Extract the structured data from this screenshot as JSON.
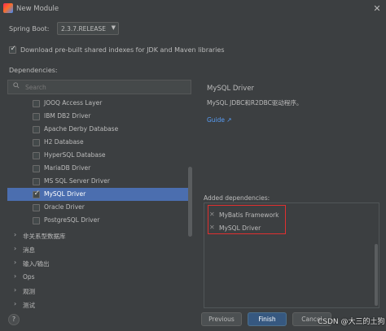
{
  "window": {
    "title": "New Module",
    "close_glyph": "✕"
  },
  "spring_boot": {
    "label": "Spring Boot:",
    "value": "2.3.7.RELEASE"
  },
  "download_indexes": {
    "label": "Download pre-built shared indexes for JDK and Maven libraries",
    "checked": true
  },
  "dependencies": {
    "label": "Dependencies:",
    "search_placeholder": "Search",
    "items": [
      {
        "label": "JOOQ Access Layer",
        "checked": false,
        "selected": false
      },
      {
        "label": "IBM DB2 Driver",
        "checked": false,
        "selected": false
      },
      {
        "label": "Apache Derby Database",
        "checked": false,
        "selected": false
      },
      {
        "label": "H2 Database",
        "checked": false,
        "selected": false
      },
      {
        "label": "HyperSQL Database",
        "checked": false,
        "selected": false
      },
      {
        "label": "MariaDB Driver",
        "checked": false,
        "selected": false
      },
      {
        "label": "MS SQL Server Driver",
        "checked": false,
        "selected": false
      },
      {
        "label": "MySQL Driver",
        "checked": true,
        "selected": true
      },
      {
        "label": "Oracle Driver",
        "checked": false,
        "selected": false
      },
      {
        "label": "PostgreSQL Driver",
        "checked": false,
        "selected": false
      }
    ],
    "groups": [
      {
        "label": "非关系型数据库"
      },
      {
        "label": "消息"
      },
      {
        "label": "输入/输出"
      },
      {
        "label": "Ops"
      },
      {
        "label": "观测"
      },
      {
        "label": "测试"
      }
    ]
  },
  "detail": {
    "title": "MySQL Driver",
    "description": "MySQL JDBC和R2DBC驱动程序。",
    "guide_link": "Guide ↗"
  },
  "added": {
    "label": "Added dependencies:",
    "items": [
      {
        "name": "MyBatis Framework"
      },
      {
        "name": "MySQL Driver"
      }
    ]
  },
  "footer": {
    "help": "?",
    "previous": "Previous",
    "finish": "Finish",
    "cancel": "Cancel"
  },
  "watermark": "CSDN @大三的土狗",
  "colors": {
    "accent": "#4b6eaf",
    "primary_button": "#365880",
    "link": "#589df6",
    "highlight_box": "#e03030"
  }
}
